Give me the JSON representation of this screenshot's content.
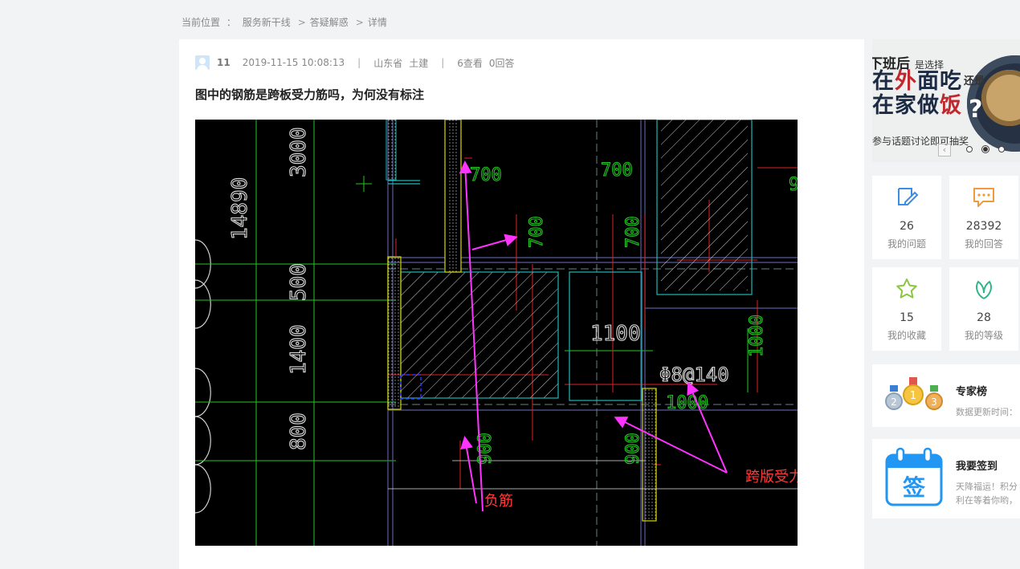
{
  "breadcrumb": {
    "label": "当前位置",
    "colon": "：",
    "items": [
      "服务新干线",
      "答疑解惑",
      "详情"
    ],
    "separator": ">"
  },
  "question": {
    "user": "11",
    "datetime": "2019-11-15 10:08:13",
    "region": "山东省",
    "category": "土建",
    "views": "6查看",
    "answers": "0回答",
    "title": "图中的钢筋是跨板受力筋吗，为何没有标注",
    "meta_divider": "|"
  },
  "drawing": {
    "dims_vertical": [
      "14890",
      "3000",
      "500",
      "1400",
      "800"
    ],
    "dims_top": [
      "700",
      "700",
      "9"
    ],
    "dims_mid": [
      "700",
      "700",
      "1000"
    ],
    "dim_1100": "1100",
    "rebar_label": "Φ8@140",
    "dim_1000": "1000",
    "dim_900_a": "900",
    "dim_900_b": "900",
    "note_negative": "负筋",
    "note_cross": "跨版受力筋"
  },
  "banner": {
    "line1": "下班后",
    "line1_small": "是选择",
    "line2a_pre": "在",
    "line2a_red": "外",
    "line2a_post": "面吃",
    "line2_small": "还是",
    "line3_pre": "在家做",
    "line3_red": "饭",
    "question_mark": "?",
    "line4": "参与话题讨论即可抽奖",
    "prev_arrow": "‹"
  },
  "stats": [
    {
      "value": "26",
      "label": "我的问题",
      "icon": "edit-icon",
      "color": "#3a8ee6"
    },
    {
      "value": "28392",
      "label": "我的回答",
      "icon": "chat-icon",
      "color": "#f29a3b"
    },
    {
      "value": "15",
      "label": "我的收藏",
      "icon": "star-icon",
      "color": "#8cc63f"
    },
    {
      "value": "28",
      "label": "我的等级",
      "icon": "leaf-icon",
      "color": "#2eb589"
    }
  ],
  "expert": {
    "title": "专家榜",
    "subtitle": "数据更新时间：",
    "medals": [
      "2",
      "1",
      "3"
    ]
  },
  "signin": {
    "title": "我要签到",
    "line1": "天降福运！积分",
    "line2": "利在等着你哟，",
    "badge": "签"
  }
}
